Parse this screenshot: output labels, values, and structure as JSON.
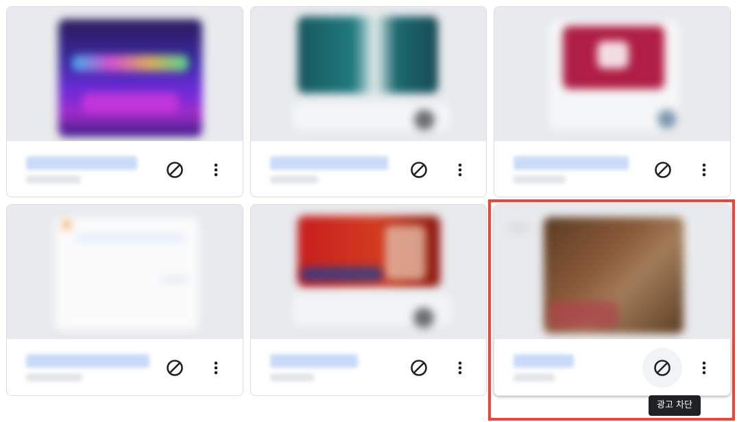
{
  "ad_cards": [
    {
      "state": "normal"
    },
    {
      "state": "normal"
    },
    {
      "state": "normal"
    },
    {
      "state": "normal"
    },
    {
      "state": "normal"
    },
    {
      "state": "hovered"
    }
  ],
  "tooltip": {
    "label": "광고 차단"
  },
  "icons": {
    "block": "block-icon",
    "more": "more-vert-icon"
  },
  "colors": {
    "highlight": "#f44336",
    "tooltip_bg": "#202124",
    "thumb_bg": "#e8eaed",
    "title_placeholder": "#c9dbf8"
  }
}
